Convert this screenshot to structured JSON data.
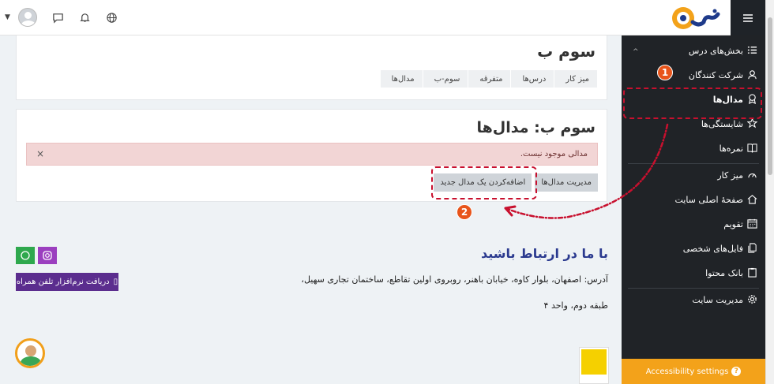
{
  "header": {
    "menu_icon": "hamburger-icon",
    "logo_icon": "site-logo-icon",
    "icons": [
      "globe-icon",
      "bell-icon",
      "chat-icon",
      "avatar",
      "caret-down-icon"
    ]
  },
  "sidebar": {
    "items": [
      {
        "label": "بخش‌های درس",
        "icon": "list-icon"
      },
      {
        "label": "شرکت کنندگان",
        "icon": "users-icon"
      },
      {
        "label": "مدال‌ها",
        "icon": "badge-icon"
      },
      {
        "label": "شایستگی‌ها",
        "icon": "star-icon"
      },
      {
        "label": "نمره‌ها",
        "icon": "book-icon"
      },
      {
        "label": "میز کار",
        "icon": "gauge-icon"
      },
      {
        "label": "صفحهٔ اصلی سایت",
        "icon": "home-icon"
      },
      {
        "label": "تقویم",
        "icon": "calendar-icon"
      },
      {
        "label": "فایل‌های شخصی",
        "icon": "files-icon"
      },
      {
        "label": "بانک محتوا",
        "icon": "clipboard-icon"
      },
      {
        "label": "مدیریت سایت",
        "icon": "cog-icon"
      }
    ],
    "accessibility": "Accessibility settings",
    "accessibility_info": "?"
  },
  "course": {
    "title": "سوم ب",
    "breadcrumbs": [
      "میز کار",
      "درس‌ها",
      "متفرقه",
      "سوم-ب",
      "مدال‌ها"
    ]
  },
  "badges_panel": {
    "title": "سوم ب: مدال‌ها",
    "alert": "مدالی موجود نیست.",
    "close": "×",
    "manage_button": "مدیریت مدال‌ها",
    "add_button": "اضافه‌کردن یک مدال جدید"
  },
  "annotations": {
    "step1": "1",
    "step2": "2",
    "color": "#c8102e"
  },
  "footer": {
    "title": "با ما در ارتباط باشید",
    "address": "آدرس: اصفهان، بلوار کاوه، خیابان باهنر، روبروی اولین تقاطع، ساختمان تجاری سهیل،",
    "floor": "طبقه دوم، واحد ۴",
    "app_button": "دریافت نرم‌افزار تلفن همراه",
    "whatsapp_icon": "whatsapp-icon",
    "instagram_icon": "instagram-icon",
    "whatsapp_color": "#2ea84d",
    "instagram_color": "#9b3fbf"
  },
  "colors": {
    "sidebar_bg": "#202327",
    "accent": "#f3a21a",
    "title_blue": "#2b3a8f"
  }
}
